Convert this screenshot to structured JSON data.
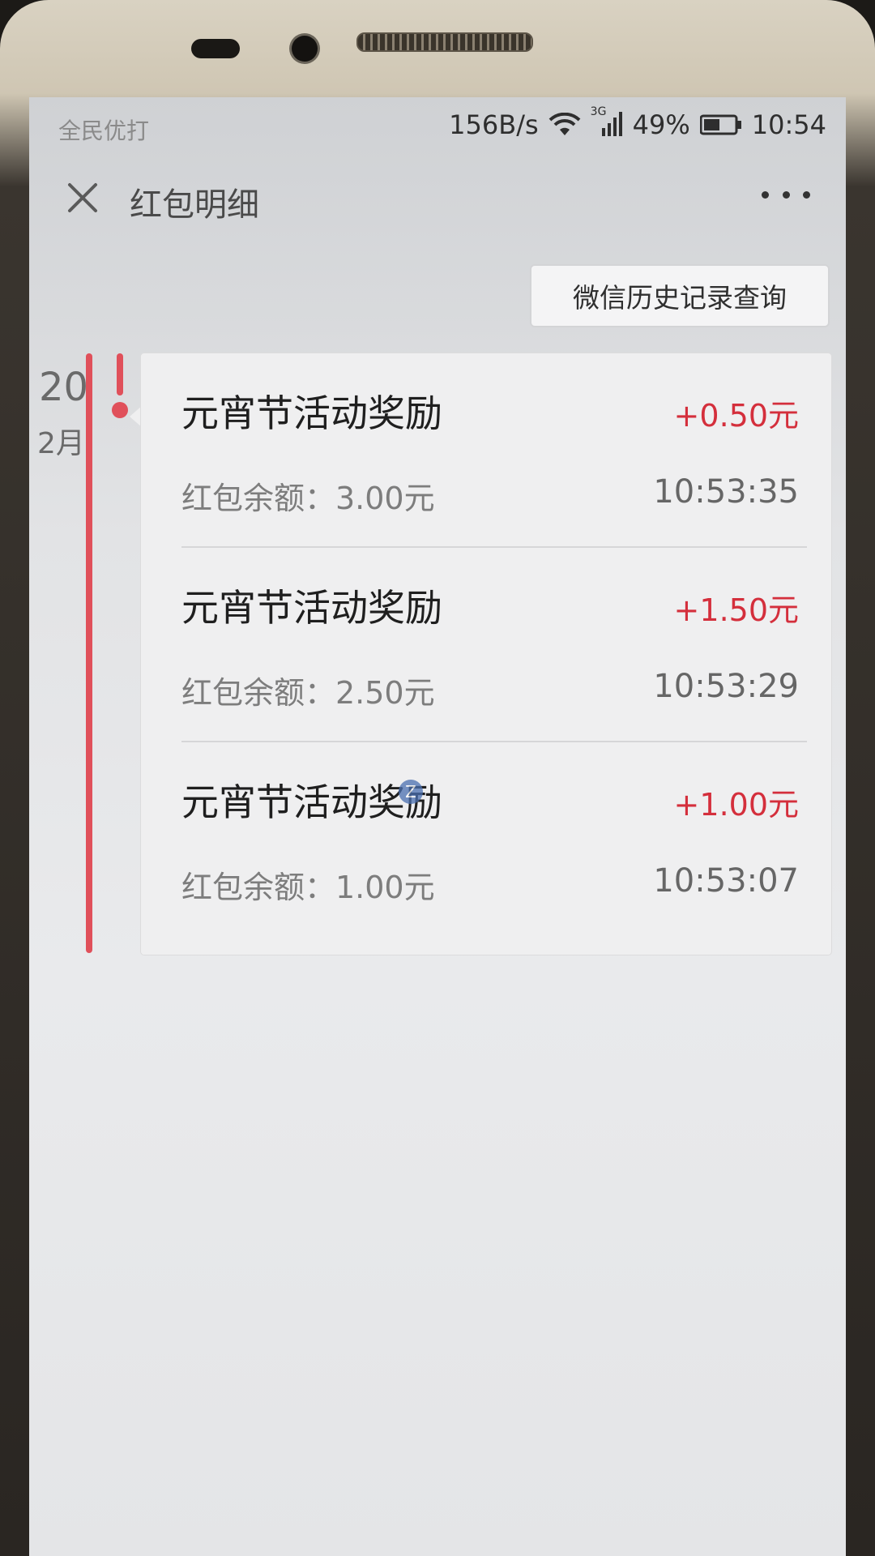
{
  "statusbar": {
    "carrier": "全民优打",
    "net_speed": "156B/s",
    "network_type": "3G",
    "battery_percent": "49%",
    "time": "10:54"
  },
  "header": {
    "title": "红包明细"
  },
  "history_button": {
    "label": "微信历史记录查询"
  },
  "timeline": {
    "day": "20",
    "month": "2月"
  },
  "records": [
    {
      "title": "元宵节活动奖励",
      "amount": "+0.50元",
      "balance": "红包余额：3.00元",
      "time": "10:53:35"
    },
    {
      "title": "元宵节活动奖励",
      "amount": "+1.50元",
      "balance": "红包余额：2.50元",
      "time": "10:53:29"
    },
    {
      "title": "元宵节活动奖励",
      "amount": "+1.00元",
      "balance": "红包余额：1.00元",
      "time": "10:53:07"
    }
  ],
  "colors": {
    "accent_red": "#d42f3c",
    "timeline_red": "#e0505a"
  }
}
